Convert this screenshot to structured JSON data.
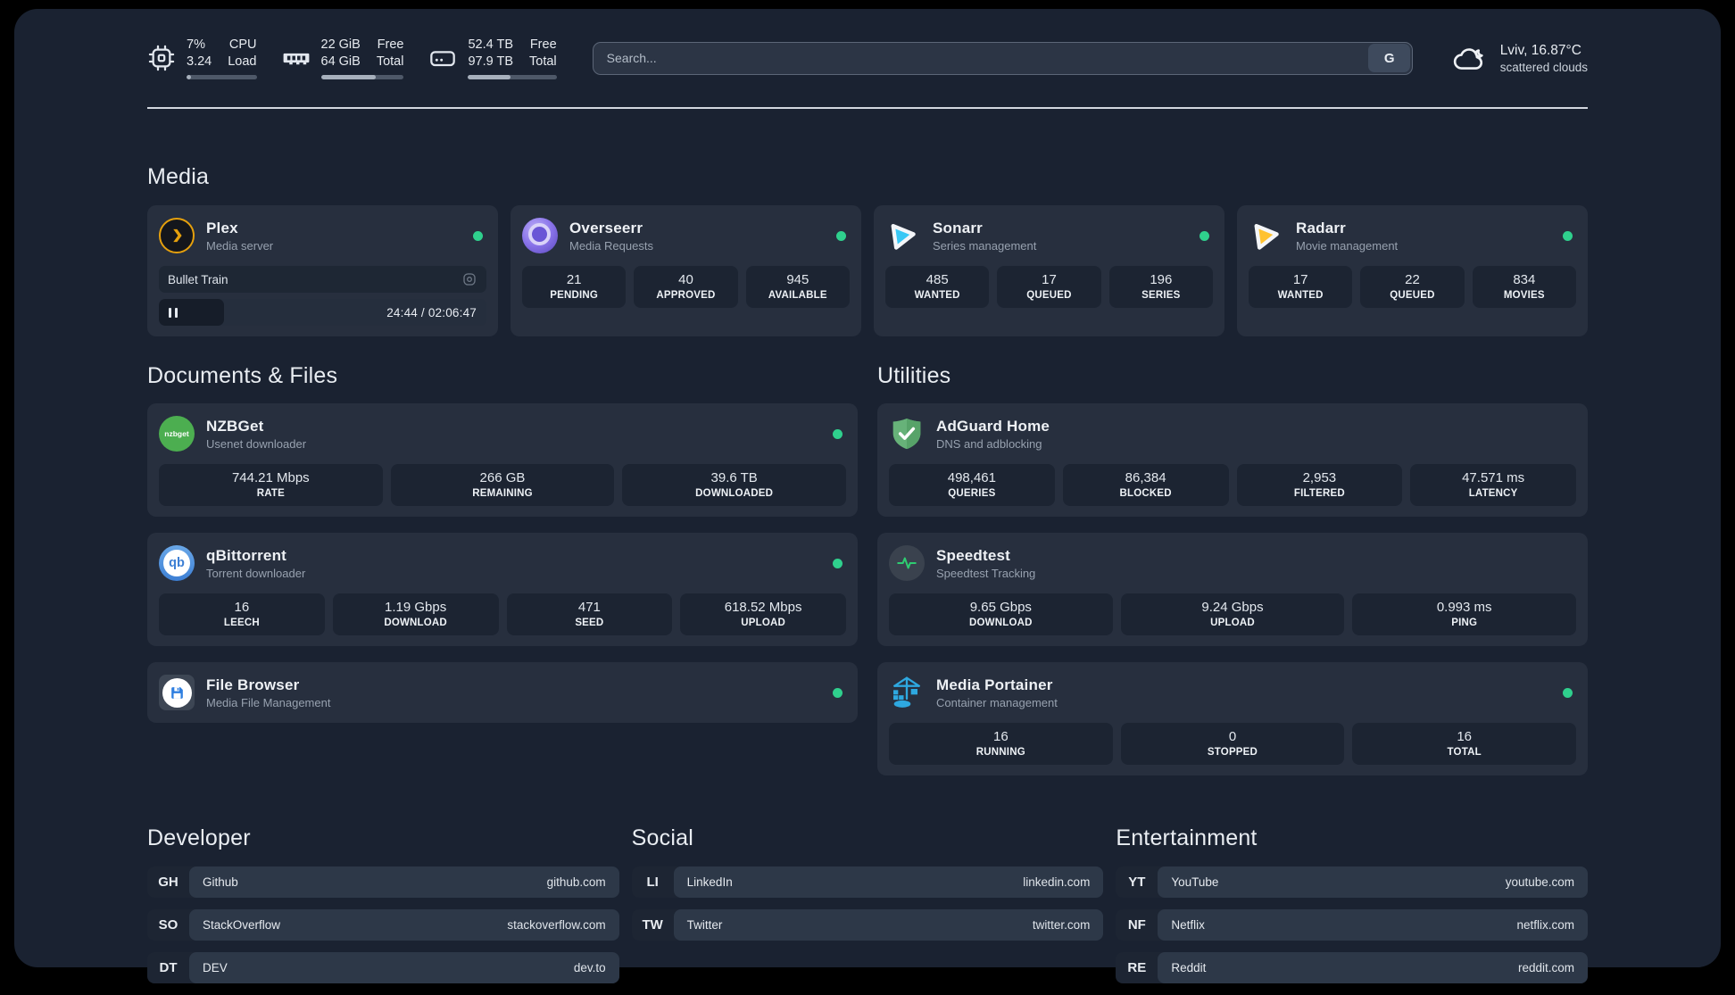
{
  "colors": {
    "status_online": "#2fd08d",
    "plex_accent": "#e5a00d",
    "sonarr_accent": "#38c8f5",
    "radarr_accent": "#ffc230",
    "nzbget_accent": "#4cae50",
    "adguard_accent": "#67b279",
    "speedtest_accent": "#2ecc71",
    "portainer_accent": "#2ea8e0",
    "filebrowser_accent": "#2f7fe0"
  },
  "topbar": {
    "cpu": {
      "value_top": "7%",
      "value_bottom": "3.24",
      "label_top": "CPU",
      "label_bottom": "Load",
      "bar_pct": 7
    },
    "memory": {
      "value_top": "22 GiB",
      "value_bottom": "64 GiB",
      "label_top": "Free",
      "label_bottom": "Total",
      "bar_pct": 66
    },
    "disk": {
      "value_top": "52.4 TB",
      "value_bottom": "97.9 TB",
      "label_top": "Free",
      "label_bottom": "Total",
      "bar_pct": 48
    },
    "search": {
      "placeholder": "Search...",
      "button_label": "G"
    },
    "weather": {
      "location": "Lviv, 16.87°C",
      "condition": "scattered clouds"
    }
  },
  "media": {
    "heading": "Media",
    "plex": {
      "title": "Plex",
      "subtitle": "Media server",
      "now_playing": "Bullet Train",
      "time": "24:44 / 02:06:47",
      "progress_pct": 20
    },
    "overseerr": {
      "title": "Overseerr",
      "subtitle": "Media Requests",
      "stats": [
        {
          "value": "21",
          "label": "PENDING"
        },
        {
          "value": "40",
          "label": "APPROVED"
        },
        {
          "value": "945",
          "label": "AVAILABLE"
        }
      ]
    },
    "sonarr": {
      "title": "Sonarr",
      "subtitle": "Series management",
      "stats": [
        {
          "value": "485",
          "label": "WANTED"
        },
        {
          "value": "17",
          "label": "QUEUED"
        },
        {
          "value": "196",
          "label": "SERIES"
        }
      ]
    },
    "radarr": {
      "title": "Radarr",
      "subtitle": "Movie management",
      "stats": [
        {
          "value": "17",
          "label": "WANTED"
        },
        {
          "value": "22",
          "label": "QUEUED"
        },
        {
          "value": "834",
          "label": "MOVIES"
        }
      ]
    }
  },
  "documents": {
    "heading": "Documents & Files",
    "nzbget": {
      "title": "NZBGet",
      "subtitle": "Usenet downloader",
      "logo_text": "nzbget",
      "stats": [
        {
          "value": "744.21 Mbps",
          "label": "RATE"
        },
        {
          "value": "266 GB",
          "label": "REMAINING"
        },
        {
          "value": "39.6 TB",
          "label": "DOWNLOADED"
        }
      ]
    },
    "qbittorrent": {
      "title": "qBittorrent",
      "subtitle": "Torrent downloader",
      "logo_text": "qb",
      "stats": [
        {
          "value": "16",
          "label": "LEECH"
        },
        {
          "value": "1.19 Gbps",
          "label": "DOWNLOAD"
        },
        {
          "value": "471",
          "label": "SEED"
        },
        {
          "value": "618.52 Mbps",
          "label": "UPLOAD"
        }
      ]
    },
    "filebrowser": {
      "title": "File Browser",
      "subtitle": "Media File Management"
    }
  },
  "utilities": {
    "heading": "Utilities",
    "adguard": {
      "title": "AdGuard Home",
      "subtitle": "DNS and adblocking",
      "stats": [
        {
          "value": "498,461",
          "label": "QUERIES"
        },
        {
          "value": "86,384",
          "label": "BLOCKED"
        },
        {
          "value": "2,953",
          "label": "FILTERED"
        },
        {
          "value": "47.571 ms",
          "label": "LATENCY"
        }
      ]
    },
    "speedtest": {
      "title": "Speedtest",
      "subtitle": "Speedtest Tracking",
      "stats": [
        {
          "value": "9.65 Gbps",
          "label": "DOWNLOAD"
        },
        {
          "value": "9.24 Gbps",
          "label": "UPLOAD"
        },
        {
          "value": "0.993 ms",
          "label": "PING"
        }
      ]
    },
    "portainer": {
      "title": "Media Portainer",
      "subtitle": "Container management",
      "stats": [
        {
          "value": "16",
          "label": "RUNNING"
        },
        {
          "value": "0",
          "label": "STOPPED"
        },
        {
          "value": "16",
          "label": "TOTAL"
        }
      ]
    }
  },
  "bookmarks": {
    "developer": {
      "heading": "Developer",
      "items": [
        {
          "abbr": "GH",
          "name": "Github",
          "url": "github.com"
        },
        {
          "abbr": "SO",
          "name": "StackOverflow",
          "url": "stackoverflow.com"
        },
        {
          "abbr": "DT",
          "name": "DEV",
          "url": "dev.to"
        }
      ]
    },
    "social": {
      "heading": "Social",
      "items": [
        {
          "abbr": "LI",
          "name": "LinkedIn",
          "url": "linkedin.com"
        },
        {
          "abbr": "TW",
          "name": "Twitter",
          "url": "twitter.com"
        }
      ]
    },
    "entertainment": {
      "heading": "Entertainment",
      "items": [
        {
          "abbr": "YT",
          "name": "YouTube",
          "url": "youtube.com"
        },
        {
          "abbr": "NF",
          "name": "Netflix",
          "url": "netflix.com"
        },
        {
          "abbr": "RE",
          "name": "Reddit",
          "url": "reddit.com"
        }
      ]
    }
  }
}
